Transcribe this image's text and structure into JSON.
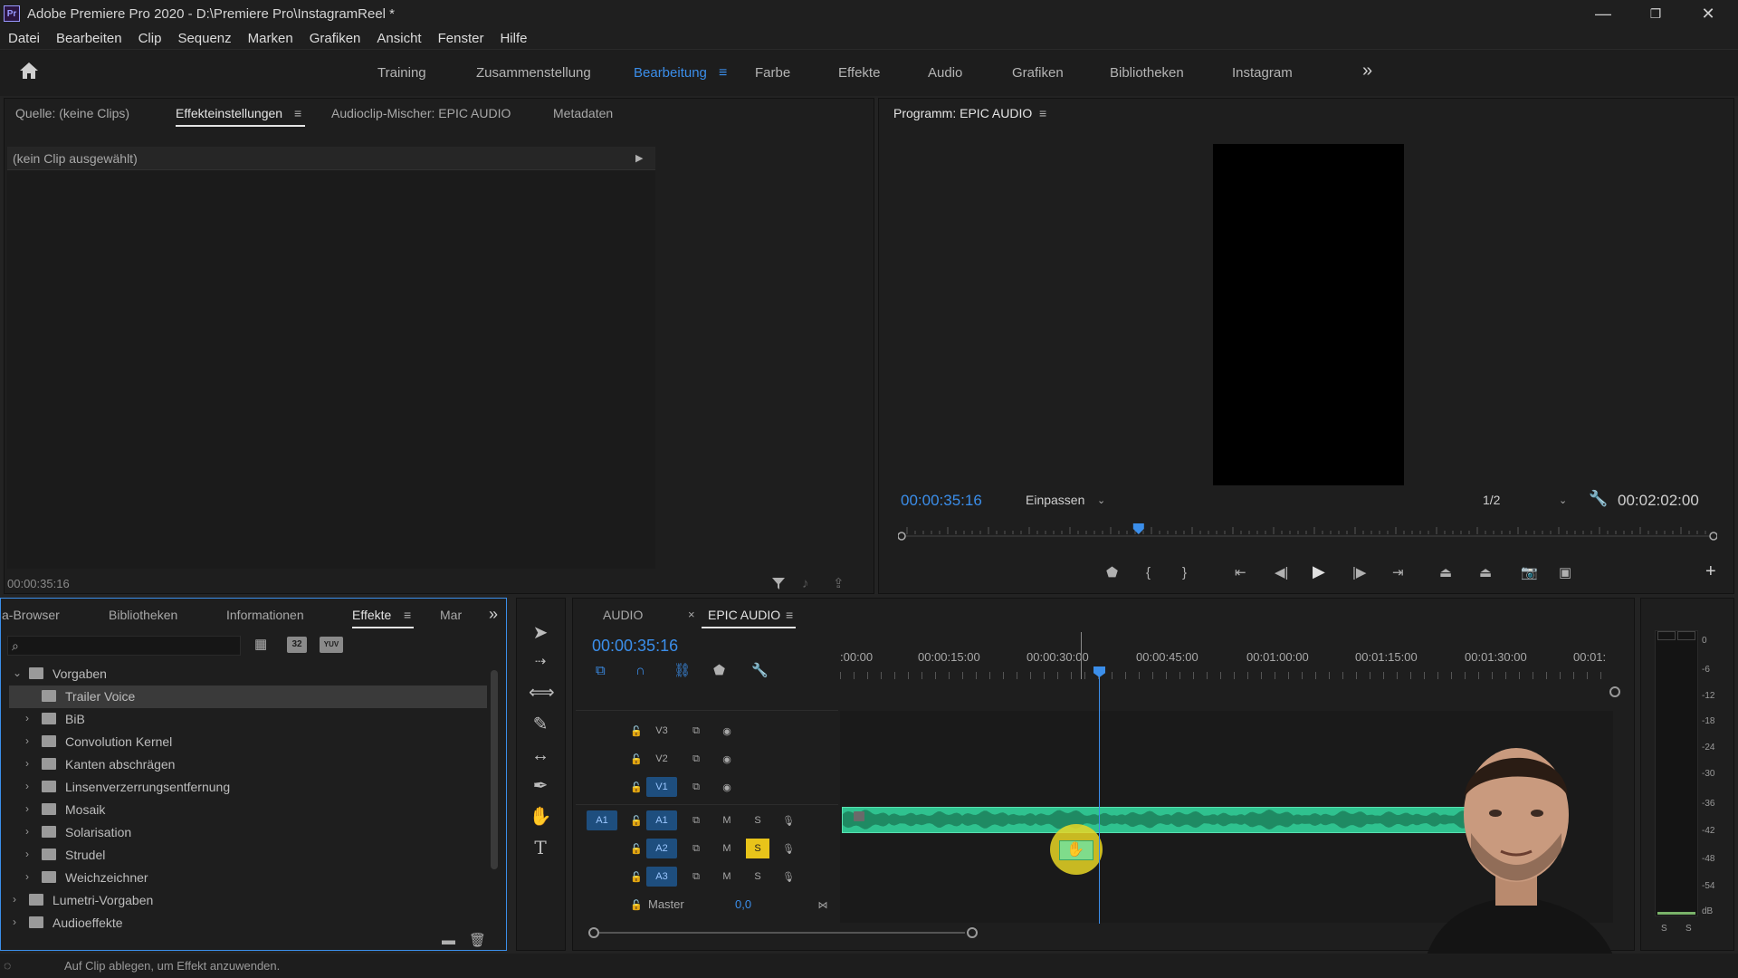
{
  "titlebar": {
    "logo": "Pr",
    "title": "Adobe Premiere Pro 2020 - D:\\Premiere Pro\\InstagramReel *",
    "minimize_glyph": "—",
    "restore_glyph": "❐",
    "close_glyph": "✕"
  },
  "menu": [
    "Datei",
    "Bearbeiten",
    "Clip",
    "Sequenz",
    "Marken",
    "Grafiken",
    "Ansicht",
    "Fenster",
    "Hilfe"
  ],
  "workspaces": {
    "items": [
      "Training",
      "Zusammenstellung",
      "Bearbeitung",
      "Farbe",
      "Effekte",
      "Audio",
      "Grafiken",
      "Bibliotheken",
      "Instagram"
    ],
    "active": "Bearbeitung",
    "overflow_glyph": "»"
  },
  "source_panel": {
    "tabs": [
      "Quelle: (keine Clips)",
      "Effekteinstellungen",
      "Audioclip-Mischer: EPIC AUDIO",
      "Metadaten"
    ],
    "active_tab": "Effekteinstellungen",
    "no_clip_label": "(kein Clip ausgewählt)",
    "timecode": "00:00:35:16"
  },
  "program_monitor": {
    "title": "Programm: EPIC AUDIO",
    "timecode": "00:00:35:16",
    "fit_label": "Einpassen",
    "resolution": "1/2",
    "duration": "00:02:02:00",
    "playhead_fraction": 0.29
  },
  "effects_panel": {
    "tabs": [
      "a-Browser",
      "Bibliotheken",
      "Informationen",
      "Effekte",
      "Mar"
    ],
    "active_tab": "Effekte",
    "search_placeholder": "",
    "badges": [
      "32",
      "YUV"
    ],
    "tree": [
      {
        "label": "Vorgaben",
        "level": 0,
        "expanded": true,
        "type": "folder"
      },
      {
        "label": "Trailer Voice",
        "level": 1,
        "expanded": false,
        "type": "preset",
        "selected": true
      },
      {
        "label": "BiB",
        "level": 1,
        "expanded": false,
        "type": "folder"
      },
      {
        "label": "Convolution Kernel",
        "level": 1,
        "expanded": false,
        "type": "folder"
      },
      {
        "label": "Kanten abschrägen",
        "level": 1,
        "expanded": false,
        "type": "folder"
      },
      {
        "label": "Linsenverzerrungsentfernung",
        "level": 1,
        "expanded": false,
        "type": "folder"
      },
      {
        "label": "Mosaik",
        "level": 1,
        "expanded": false,
        "type": "folder"
      },
      {
        "label": "Solarisation",
        "level": 1,
        "expanded": false,
        "type": "folder"
      },
      {
        "label": "Strudel",
        "level": 1,
        "expanded": false,
        "type": "folder"
      },
      {
        "label": "Weichzeichner",
        "level": 1,
        "expanded": false,
        "type": "folder"
      },
      {
        "label": "Lumetri-Vorgaben",
        "level": 0,
        "expanded": false,
        "type": "folder"
      },
      {
        "label": "Audioeffekte",
        "level": 0,
        "expanded": false,
        "type": "folder"
      }
    ]
  },
  "timeline": {
    "tabs": [
      "AUDIO",
      "EPIC AUDIO"
    ],
    "active_tab": "EPIC AUDIO",
    "timecode": "00:00:35:16",
    "ruler_labels": [
      ":00:00",
      "00:00:15:00",
      "00:00:30:00",
      "00:00:45:00",
      "00:01:00:00",
      "00:01:15:00",
      "00:01:30:00",
      "00:01:"
    ],
    "video_tracks": [
      "V3",
      "V2",
      "V1"
    ],
    "audio_tracks": [
      "A1",
      "A2",
      "A3"
    ],
    "source_patch": "A1",
    "mute_label": "M",
    "solo_label": "S",
    "solo_active_track": "A2",
    "master_label": "Master",
    "master_value": "0,0"
  },
  "meter": {
    "labels": [
      "0",
      "-6",
      "-12",
      "-18",
      "-24",
      "-30",
      "-36",
      "-42",
      "-48",
      "-54",
      "dB"
    ],
    "bottom": [
      "S",
      "S"
    ]
  },
  "status": {
    "message": "Auf Clip ablegen, um Effekt anzuwenden."
  },
  "colors": {
    "accent": "#3b8eea",
    "audio_clip": "#2fc28f",
    "solo": "#e8c41a",
    "panel_bg": "#1e1e1e",
    "app_bg": "#232323"
  }
}
